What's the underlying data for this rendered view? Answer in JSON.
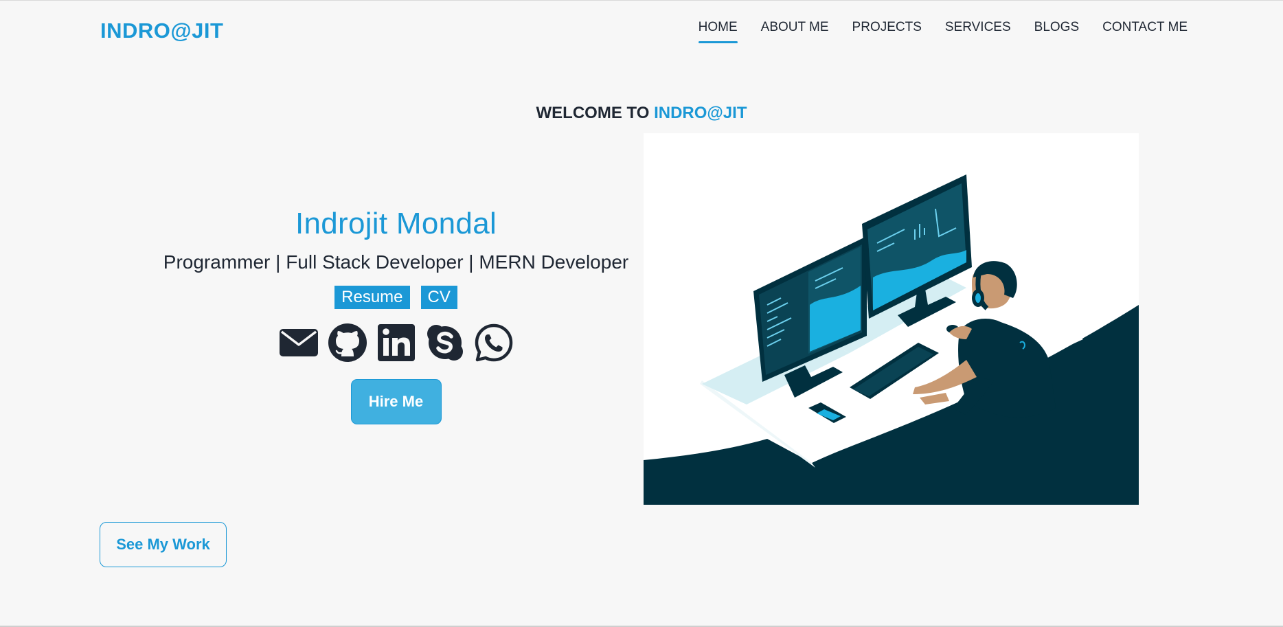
{
  "brand": {
    "name": "INDRO@JIT"
  },
  "nav": {
    "items": [
      {
        "label": "HOME",
        "active": true
      },
      {
        "label": "ABOUT ME",
        "active": false
      },
      {
        "label": "PROJECTS",
        "active": false
      },
      {
        "label": "SERVICES",
        "active": false
      },
      {
        "label": "BLOGS",
        "active": false
      },
      {
        "label": "CONTACT ME",
        "active": false
      }
    ]
  },
  "welcome": {
    "prefix": "WELCOME TO",
    "highlight": "INDRO@JIT"
  },
  "hero": {
    "name": "Indrojit Mondal",
    "role": "Programmer | Full Stack Developer | MERN Developer",
    "doc_links": [
      {
        "label": "Resume"
      },
      {
        "label": "CV"
      }
    ],
    "socials": [
      {
        "icon": "email-icon"
      },
      {
        "icon": "github-icon"
      },
      {
        "icon": "linkedin-icon"
      },
      {
        "icon": "skype-icon"
      },
      {
        "icon": "whatsapp-icon"
      }
    ],
    "hire_label": "Hire Me"
  },
  "see_work_label": "See My Work",
  "colors": {
    "accent": "#1b98d6",
    "text": "#1f2733",
    "background": "#f7f7f7",
    "illustration_dark": "#01303f"
  }
}
